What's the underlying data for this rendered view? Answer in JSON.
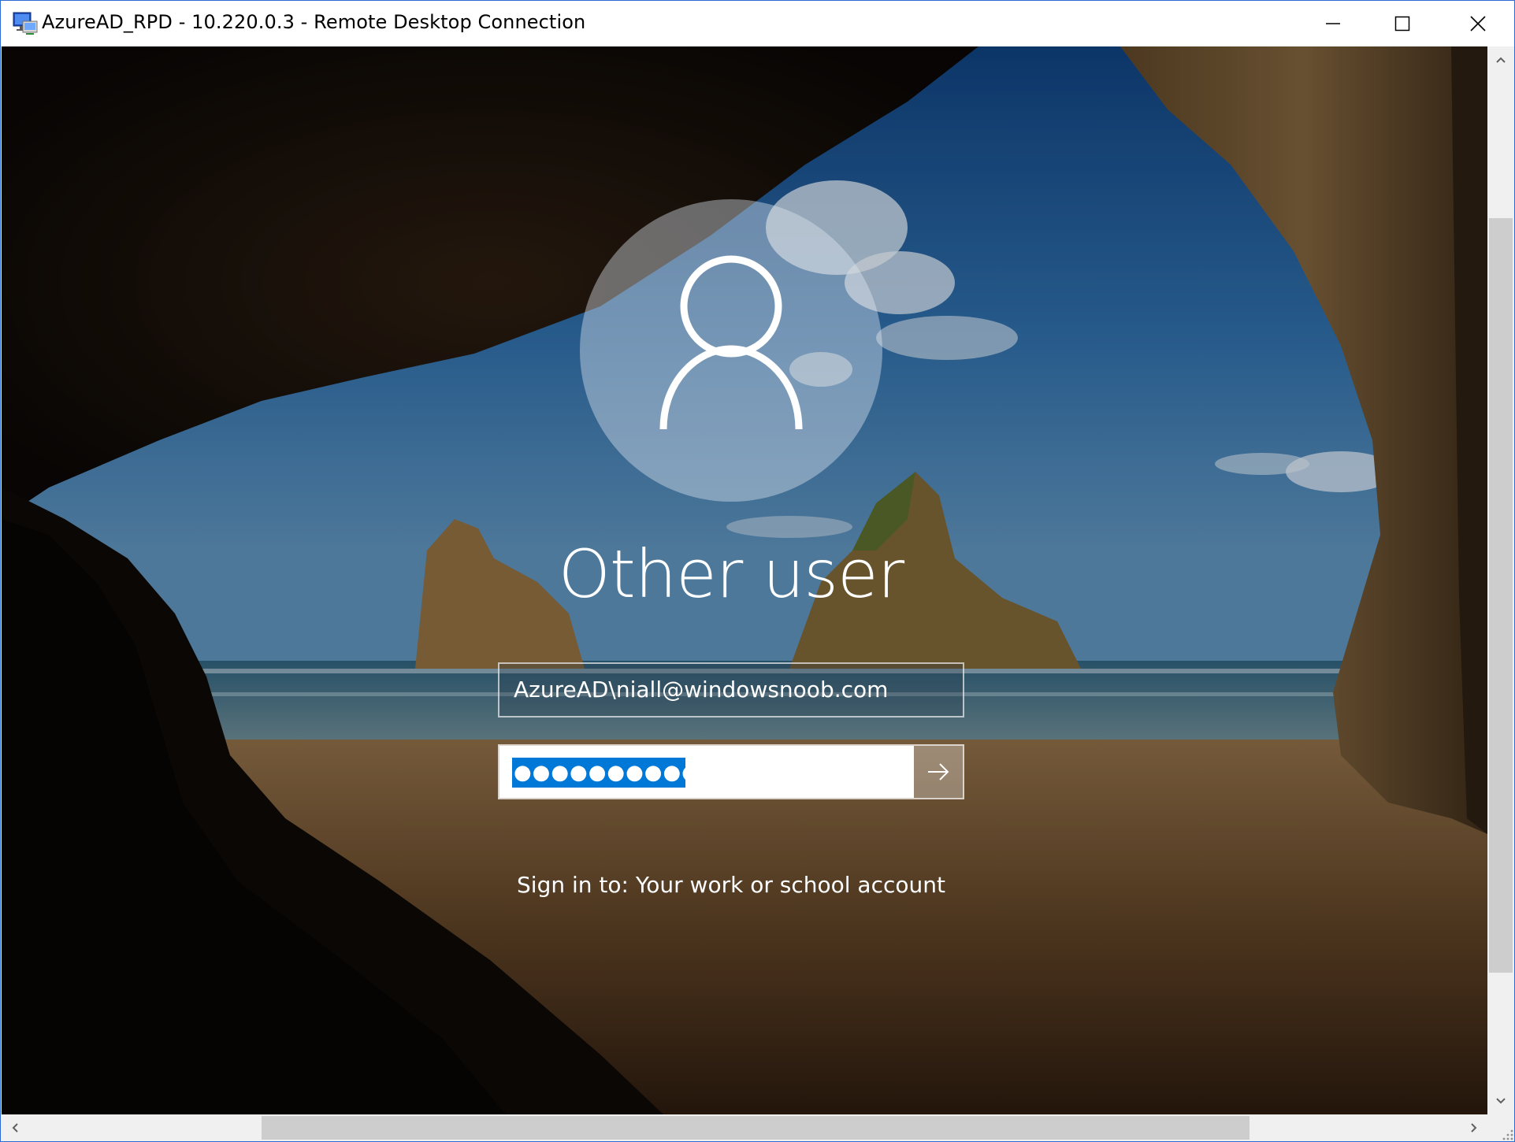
{
  "window": {
    "title": "AzureAD_RPD - 10.220.0.3 - Remote Desktop Connection",
    "icons": {
      "app": "remote-desktop-icon",
      "minimize": "minimize-icon",
      "maximize": "maximize-icon",
      "close": "close-icon"
    }
  },
  "login": {
    "avatar_icon": "user-icon",
    "user_name": "Other user",
    "username_value": "AzureAD\\niall@windowsnoob.com",
    "password_value": "●●●●●●●●●●●●",
    "submit_icon": "arrow-right-icon",
    "sign_in_to": "Sign in to: Your work or school account"
  },
  "scrollbars": {
    "icons": {
      "up": "chevron-up-icon",
      "down": "chevron-down-icon",
      "left": "chevron-left-icon",
      "right": "chevron-right-icon",
      "grip": "size-grip-icon"
    }
  },
  "colors": {
    "window_border": "#2b6cd4",
    "selection": "#0078d7",
    "titlebar": "#ffffff",
    "scrollbar_track": "#f0f0f0",
    "scrollbar_thumb": "#cdcdcd"
  }
}
